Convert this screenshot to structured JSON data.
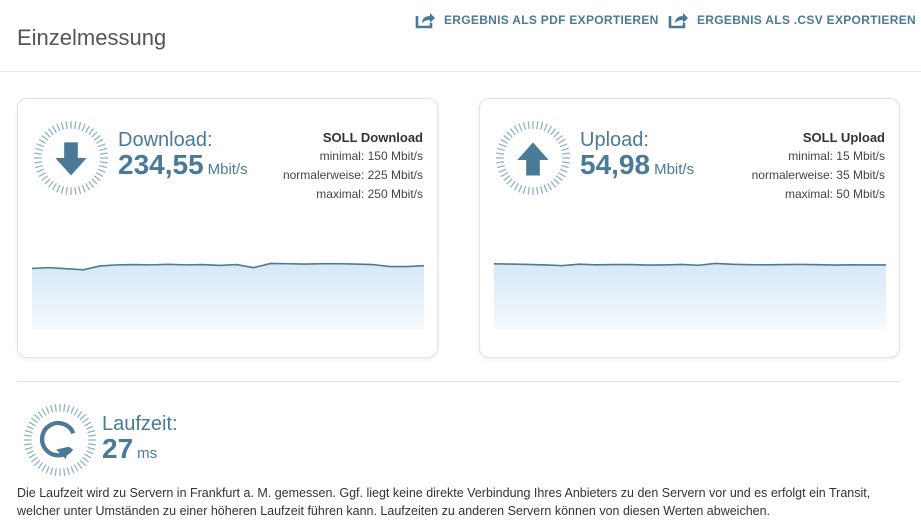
{
  "page": {
    "title": "Einzelmessung"
  },
  "exports": {
    "pdf_label": "ERGEBNIS ALS PDF EXPORTIEREN",
    "csv_label": "ERGEBNIS ALS .CSV EXPORTIEREN"
  },
  "colors": {
    "accent": "#4a7a96",
    "chart_line": "#4a7a96",
    "chart_fill_top": "#d6e8f6",
    "chart_fill_bottom": "#f4f9fd"
  },
  "download": {
    "label": "Download:",
    "value": "234,55",
    "unit": "Mbit/s",
    "icon": "arrow-down-icon",
    "soll_title": "SOLL Download",
    "minimal": "minimal: 150 Mbit/s",
    "normal": "normalerweise: 225 Mbit/s",
    "maximal": "maximal: 250 Mbit/s",
    "series": [
      219,
      222,
      218,
      214,
      228,
      232,
      233,
      232,
      234,
      232,
      233,
      230,
      233,
      222,
      237,
      236,
      235,
      236,
      236,
      235,
      233,
      226,
      226,
      229
    ]
  },
  "upload": {
    "label": "Upload:",
    "value": "54,98",
    "unit": "Mbit/s",
    "icon": "arrow-up-icon",
    "soll_title": "SOLL Upload",
    "minimal": "minimal: 15 Mbit/s",
    "normal": "normalerweise: 35 Mbit/s",
    "maximal": "maximal: 50 Mbit/s",
    "series": [
      55,
      54.8,
      54.5,
      54.1,
      53.5,
      54.7,
      54.2,
      54.4,
      54.4,
      54.0,
      54.1,
      54.5,
      53.8,
      55.3,
      54.6,
      54.3,
      54.2,
      54.4,
      54.5,
      54.3,
      54.0,
      54.2,
      54.1,
      54.1
    ]
  },
  "ping": {
    "label": "Laufzeit:",
    "value": "27",
    "unit": "ms",
    "icon": "reload-icon",
    "note": "Die Laufzeit wird zu Servern in Frankfurt a. M. gemessen. Ggf. liegt keine direkte Verbindung Ihres Anbieters zu den Servern vor und es erfolgt ein Transit, welcher unter Umständen zu einer höheren Laufzeit führen kann. Laufzeiten zu anderen Servern können von diesen Werten abweichen."
  }
}
